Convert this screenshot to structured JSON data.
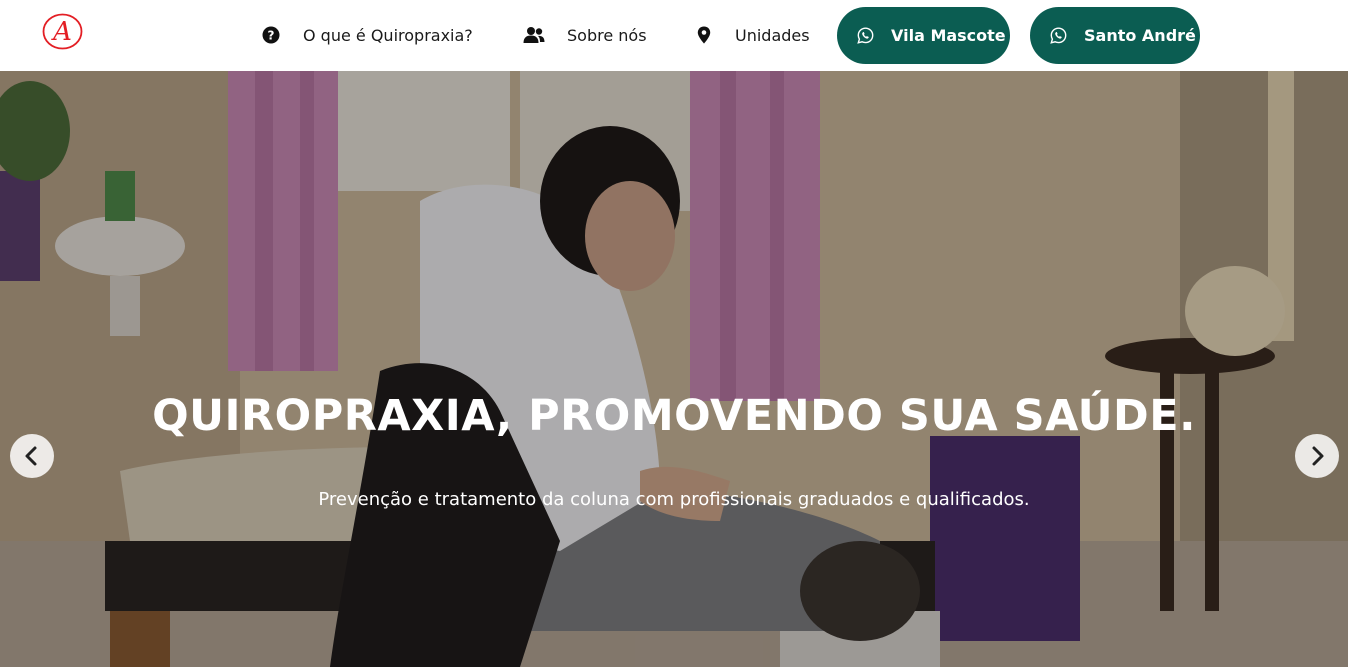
{
  "header": {
    "logo_letter": "A",
    "logo_color": "#e31e24",
    "nav": [
      {
        "label": "O que é Quiropraxia?",
        "icon": "question-circle-icon"
      },
      {
        "label": "Sobre nós",
        "icon": "users-icon"
      },
      {
        "label": "Unidades",
        "icon": "map-marker-icon"
      }
    ],
    "buttons": [
      {
        "label": "Vila Mascote",
        "icon": "whatsapp-icon"
      },
      {
        "label": "Santo André",
        "icon": "whatsapp-icon"
      }
    ],
    "button_color": "#0b5d52"
  },
  "hero": {
    "title": "QUIROPRAXIA, PROMOVENDO SUA SAÚDE.",
    "subtitle": "Prevenção e tratamento da coluna com profissionais graduados e qualificados.",
    "prev_icon": "chevron-left-icon",
    "next_icon": "chevron-right-icon"
  }
}
